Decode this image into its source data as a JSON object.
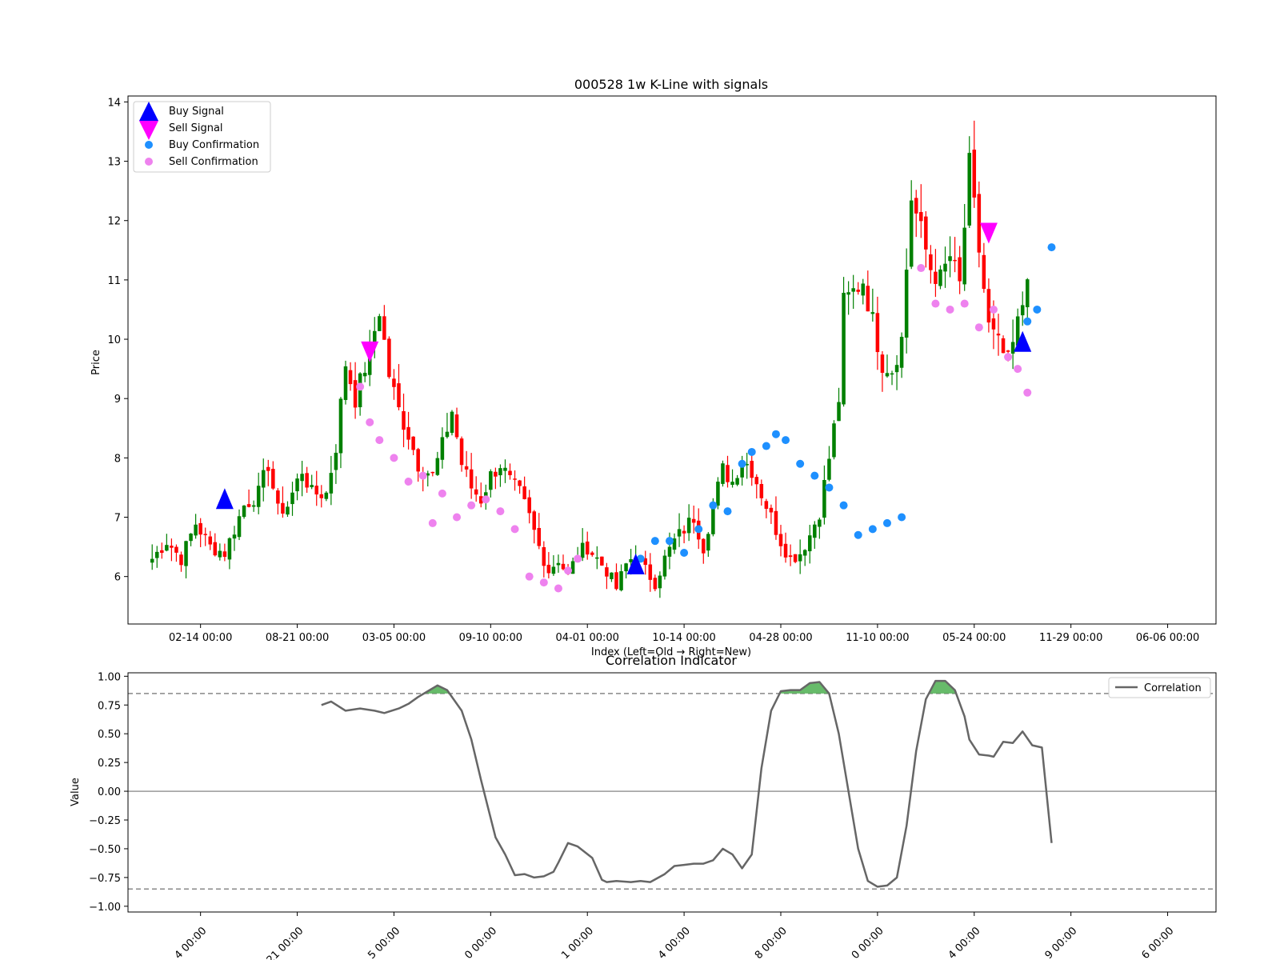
{
  "chart_data": [
    {
      "type": "candlestick",
      "title": "000528 1w K-Line with signals",
      "xlabel": "Index (Left=Old → Right=New)",
      "ylabel": "Price",
      "ylim": [
        5.2,
        14.1
      ],
      "yticks": [
        "6",
        "7",
        "8",
        "9",
        "10",
        "11",
        "12",
        "13",
        "14"
      ],
      "xlim": [
        -5,
        220
      ],
      "xtick_positions": [
        10,
        30,
        50,
        70,
        90,
        110,
        130,
        150,
        170,
        190,
        210
      ],
      "xtick_labels": [
        "02-14 00:00",
        "08-21 00:00",
        "03-05 00:00",
        "09-10 00:00",
        "04-01 00:00",
        "10-14 00:00",
        "04-28 00:00",
        "11-10 00:00",
        "05-24 00:00",
        "11-29 00:00",
        "06-06 00:00"
      ],
      "up_color": "#008000",
      "down_color": "#ff0000",
      "close_anchors": [
        [
          0,
          6.3
        ],
        [
          3,
          6.6
        ],
        [
          6,
          6.3
        ],
        [
          9,
          6.9
        ],
        [
          12,
          6.5
        ],
        [
          15,
          6.4
        ],
        [
          17,
          6.8
        ],
        [
          19,
          7.2
        ],
        [
          22,
          7.4
        ],
        [
          24,
          7.9
        ],
        [
          26,
          7.1
        ],
        [
          28,
          7.2
        ],
        [
          31,
          7.8
        ],
        [
          33,
          7.4
        ],
        [
          36,
          7.4
        ],
        [
          38,
          8.2
        ],
        [
          40,
          9.6
        ],
        [
          42,
          9.0
        ],
        [
          45,
          9.8
        ],
        [
          47,
          10.5
        ],
        [
          49,
          9.4
        ],
        [
          51,
          8.8
        ],
        [
          53,
          8.4
        ],
        [
          55,
          7.9
        ],
        [
          58,
          7.7
        ],
        [
          60,
          8.2
        ],
        [
          62,
          8.8
        ],
        [
          64,
          7.9
        ],
        [
          66,
          7.5
        ],
        [
          68,
          7.3
        ],
        [
          70,
          7.7
        ],
        [
          72,
          7.9
        ],
        [
          74,
          7.6
        ],
        [
          76,
          7.4
        ],
        [
          78,
          7.0
        ],
        [
          80,
          6.5
        ],
        [
          82,
          6.1
        ],
        [
          84,
          6.3
        ],
        [
          86,
          6.0
        ],
        [
          88,
          6.4
        ],
        [
          90,
          6.5
        ],
        [
          92,
          6.3
        ],
        [
          94,
          6.1
        ],
        [
          96,
          5.8
        ],
        [
          98,
          6.2
        ],
        [
          100,
          6.4
        ],
        [
          102,
          6.1
        ],
        [
          104,
          5.9
        ],
        [
          106,
          6.3
        ],
        [
          108,
          6.6
        ],
        [
          110,
          6.8
        ],
        [
          112,
          7.0
        ],
        [
          114,
          6.5
        ],
        [
          116,
          7.2
        ],
        [
          118,
          7.8
        ],
        [
          120,
          7.6
        ],
        [
          122,
          8.0
        ],
        [
          124,
          7.8
        ],
        [
          126,
          7.4
        ],
        [
          128,
          7.0
        ],
        [
          130,
          6.6
        ],
        [
          132,
          6.3
        ],
        [
          134,
          6.4
        ],
        [
          136,
          6.7
        ],
        [
          138,
          7.1
        ],
        [
          140,
          8.0
        ],
        [
          142,
          9.0
        ],
        [
          143,
          10.6
        ],
        [
          145,
          10.8
        ],
        [
          147,
          11.0
        ],
        [
          149,
          10.3
        ],
        [
          151,
          9.6
        ],
        [
          153,
          9.5
        ],
        [
          155,
          10.0
        ],
        [
          157,
          12.4
        ],
        [
          159,
          11.8
        ],
        [
          161,
          11.2
        ],
        [
          163,
          11.0
        ],
        [
          165,
          11.4
        ],
        [
          167,
          10.9
        ],
        [
          169,
          12.9
        ],
        [
          171,
          11.5
        ],
        [
          173,
          10.2
        ],
        [
          175,
          9.9
        ],
        [
          177,
          9.6
        ],
        [
          178,
          9.9
        ],
        [
          180,
          10.6
        ],
        [
          181,
          11.2
        ]
      ],
      "signals": {
        "buy_signal": [
          [
            15,
            7.3
          ],
          [
            100,
            6.2
          ],
          [
            180,
            9.95
          ]
        ],
        "sell_signal": [
          [
            45,
            9.8
          ],
          [
            173,
            11.8
          ]
        ],
        "buy_confirmation": [
          [
            101,
            6.3
          ],
          [
            104,
            6.6
          ],
          [
            107,
            6.6
          ],
          [
            110,
            6.4
          ],
          [
            113,
            6.8
          ],
          [
            116,
            7.2
          ],
          [
            119,
            7.1
          ],
          [
            122,
            7.9
          ],
          [
            124,
            8.1
          ],
          [
            127,
            8.2
          ],
          [
            129,
            8.4
          ],
          [
            131,
            8.3
          ],
          [
            134,
            7.9
          ],
          [
            137,
            7.7
          ],
          [
            140,
            7.5
          ],
          [
            143,
            7.2
          ],
          [
            146,
            6.7
          ],
          [
            149,
            6.8
          ],
          [
            152,
            6.9
          ],
          [
            155,
            7.0
          ],
          [
            181,
            10.3
          ],
          [
            183,
            10.5
          ],
          [
            186,
            11.55
          ]
        ],
        "sell_confirmation": [
          [
            43,
            9.2
          ],
          [
            45,
            8.6
          ],
          [
            47,
            8.3
          ],
          [
            50,
            8.0
          ],
          [
            53,
            7.6
          ],
          [
            56,
            7.7
          ],
          [
            58,
            6.9
          ],
          [
            60,
            7.4
          ],
          [
            63,
            7.0
          ],
          [
            66,
            7.2
          ],
          [
            69,
            7.3
          ],
          [
            72,
            7.1
          ],
          [
            75,
            6.8
          ],
          [
            78,
            6.0
          ],
          [
            81,
            5.9
          ],
          [
            84,
            5.8
          ],
          [
            86,
            6.1
          ],
          [
            88,
            6.3
          ],
          [
            159,
            11.2
          ],
          [
            162,
            10.6
          ],
          [
            165,
            10.5
          ],
          [
            168,
            10.6
          ],
          [
            171,
            10.2
          ],
          [
            174,
            10.5
          ],
          [
            177,
            9.7
          ],
          [
            179,
            9.5
          ],
          [
            181,
            9.1
          ]
        ]
      },
      "legend": {
        "placement": "upper-left",
        "entries": [
          "Buy Signal",
          "Sell Signal",
          "Buy Confirmation",
          "Sell Confirmation"
        ]
      },
      "colors": {
        "buy_signal": "#0000ff",
        "sell_signal": "#ff00ff",
        "buy_confirmation": "#1e90ff",
        "sell_confirmation": "#ee82ee"
      }
    },
    {
      "type": "line",
      "title": "Correlation Indicator",
      "xlabel": "",
      "ylabel": "Value",
      "ylim": [
        -1.05,
        1.03
      ],
      "yticks": [
        "1.00",
        "0.75",
        "0.50",
        "0.25",
        "0.00",
        "−0.25",
        "−0.50",
        "−0.75",
        "−1.00"
      ],
      "ytick_values": [
        1,
        0.75,
        0.5,
        0.25,
        0,
        -0.25,
        -0.5,
        -0.75,
        -1
      ],
      "xtick_labels": [
        "4 00:00",
        "21 00:00",
        "5 00:00",
        "0 00:00",
        "1 00:00",
        "4 00:00",
        "8 00:00",
        "0 00:00",
        "4 00:00",
        "9 00:00",
        "6 00:00"
      ],
      "threshold_upper": 0.85,
      "threshold_lower": -0.85,
      "zero_line": 0,
      "fill_color": "#4caf50",
      "line_color": "#666666",
      "legend": {
        "placement": "upper-right",
        "entries": [
          "Correlation"
        ]
      },
      "series": [
        {
          "name": "Correlation",
          "x": [
            35,
            37,
            40,
            43,
            46,
            48,
            51,
            53,
            55,
            57,
            59,
            61,
            64,
            66,
            68,
            71,
            73,
            75,
            77,
            79,
            81,
            83,
            84,
            86,
            88,
            91,
            93,
            94,
            96,
            99,
            101,
            103,
            106,
            108,
            110,
            112,
            114,
            116,
            118,
            120,
            122,
            124,
            126,
            128,
            130,
            132,
            134,
            136,
            138,
            140,
            142,
            144,
            146,
            148,
            150,
            152,
            154,
            156,
            158,
            160,
            162,
            164,
            166,
            168,
            169,
            171,
            173,
            174,
            176,
            178,
            180,
            182,
            184,
            186
          ],
          "values": [
            0.75,
            0.78,
            0.7,
            0.72,
            0.7,
            0.68,
            0.72,
            0.76,
            0.82,
            0.87,
            0.92,
            0.88,
            0.7,
            0.45,
            0.1,
            -0.4,
            -0.55,
            -0.73,
            -0.72,
            -0.75,
            -0.74,
            -0.7,
            -0.62,
            -0.45,
            -0.48,
            -0.58,
            -0.77,
            -0.79,
            -0.78,
            -0.79,
            -0.78,
            -0.79,
            -0.72,
            -0.65,
            -0.64,
            -0.63,
            -0.63,
            -0.6,
            -0.5,
            -0.55,
            -0.67,
            -0.55,
            0.2,
            0.7,
            0.87,
            0.88,
            0.88,
            0.94,
            0.95,
            0.85,
            0.5,
            0.0,
            -0.5,
            -0.78,
            -0.83,
            -0.82,
            -0.75,
            -0.3,
            0.35,
            0.8,
            0.96,
            0.96,
            0.88,
            0.65,
            0.45,
            0.32,
            0.31,
            0.3,
            0.43,
            0.42,
            0.52,
            0.4,
            0.38,
            -0.45
          ]
        }
      ]
    }
  ]
}
